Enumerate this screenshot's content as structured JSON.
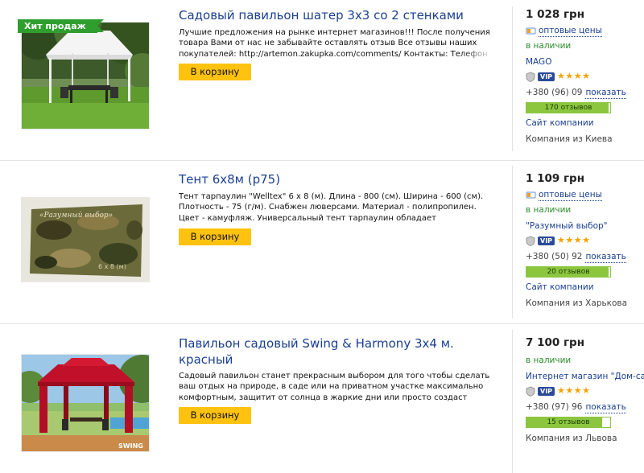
{
  "products": [
    {
      "badge": "Хит продаж",
      "title": "Садовый павильон шатер 3х3 со 2 стенками",
      "description": "Лучшие предложения на рынке интернет магазинов!!! После получения товара Вами от нас не забывайте оставлять отзыв Все отзывы наших покупателей: http://artemon.zakupka.com/comments/ Контакты: Телефон для связи",
      "cart_label": "В корзину",
      "price": "1 028 грн",
      "wholesale": "оптовые цены",
      "stock": "в наличии",
      "seller": "MAGO",
      "vip": "VIP",
      "stars": "★★★★",
      "phone": "+380 (96) 09",
      "phone_show": "показать",
      "reviews": "170 отзывов",
      "reviews_fill": 0.98,
      "site": "Сайт компании",
      "location": "Компания из Киева"
    },
    {
      "badge": "",
      "title": "Тент 6х8м (р75)",
      "description": "Тент тарпаулин \"Welltex\" 6 х 8 (м). Длина - 800 (см). Ширина - 600 (см). Плотность - 75 (г/м). Снабжен люверсами. Материал - полипропилен. Цвет - камуфляж. Универсальный тент тарпаулин обладает водонепроницаемостью, морозостойкостью",
      "cart_label": "В корзину",
      "price": "1 109 грн",
      "wholesale": "оптовые цены",
      "stock": "в наличии",
      "seller": "\"Разумный выбор\"",
      "vip": "VIP",
      "stars": "★★★★",
      "phone": "+380 (50) 92",
      "phone_show": "показать",
      "reviews": "20 отзывов",
      "reviews_fill": 0.98,
      "site": "Сайт компании",
      "location": "Компания из Харькова"
    },
    {
      "badge": "",
      "title": "Павильон садовый Swing & Harmony 3х4 м. красный",
      "description": "Садовый павильон станет прекрасным выбором для того чтобы сделать ваш отдых на природе, в саде или на приватном участке максимально комфортным, защитит от солнца в жаркие дни или просто создаст приятную атмосферу",
      "cart_label": "В корзину",
      "price": "7 100 грн",
      "wholesale": "",
      "stock": "в наличии",
      "seller": "Интернет магазин \"Дом-сад\"",
      "vip": "VIP",
      "stars": "★★★★",
      "phone": "+380 (97) 96",
      "phone_show": "показать",
      "reviews": "15 отзывов",
      "reviews_fill": 0.9,
      "site": "",
      "location": "Компания из Львова"
    }
  ],
  "image_text": {
    "tent_label": "«Разумный выбор»",
    "tent_size": "6 x 8 (м)",
    "gazebo_watermark": "SWING"
  }
}
